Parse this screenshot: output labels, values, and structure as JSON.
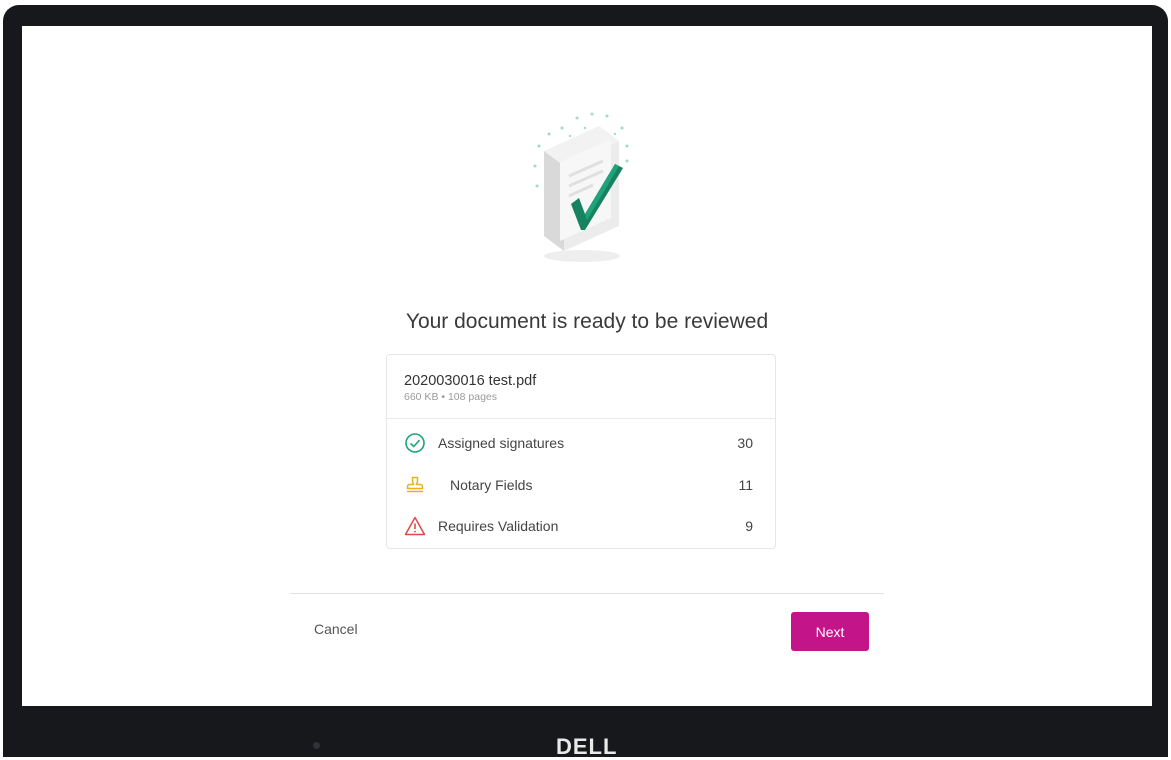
{
  "dialog": {
    "title": "Your document is ready to be reviewed",
    "file": {
      "name": "2020030016 test.pdf",
      "meta": "660 KB • 108 pages"
    },
    "summary": [
      {
        "icon": "check-circle-icon",
        "label": "Assigned signatures",
        "count": "30",
        "color": "#1fa37a"
      },
      {
        "icon": "stamp-icon",
        "label": "Notary Fields",
        "count": "11",
        "color": "#e6b31e"
      },
      {
        "icon": "warning-triangle-icon",
        "label": "Requires Validation",
        "count": "9",
        "color": "#e04848"
      }
    ],
    "actions": {
      "cancel_label": "Cancel",
      "next_label": "Next"
    }
  },
  "device": {
    "brand": "DELL"
  },
  "colors": {
    "accent": "#c4148a",
    "success": "#1fa37a",
    "warning": "#e6b31e",
    "danger": "#e04848"
  }
}
